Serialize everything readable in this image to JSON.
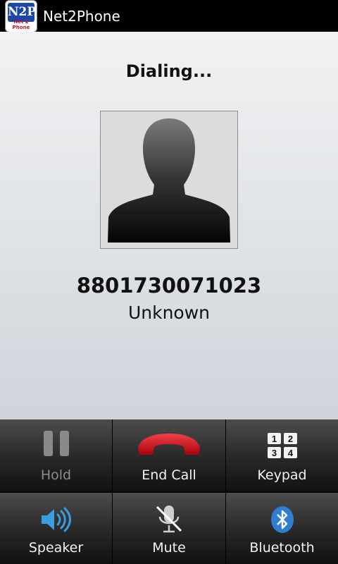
{
  "titlebar": {
    "app_title": "Net2Phone",
    "logo_mark": "N2P",
    "logo_caption": "Net 2 Phone"
  },
  "call": {
    "status": "Dialing...",
    "number": "8801730071023",
    "name": "Unknown",
    "photo": "default-silhouette-icon"
  },
  "controls": {
    "hold": {
      "label": "Hold",
      "icon": "pause-icon",
      "enabled": false
    },
    "end_call": {
      "label": "End Call",
      "icon": "phone-hangup-icon",
      "color": "#d0121b"
    },
    "keypad": {
      "label": "Keypad",
      "icon": "keypad-icon",
      "keys": [
        "1",
        "2",
        "3",
        "4"
      ]
    },
    "speaker": {
      "label": "Speaker",
      "icon": "speaker-icon",
      "color": "#3a9de0"
    },
    "mute": {
      "label": "Mute",
      "icon": "mic-muted-icon"
    },
    "bluetooth": {
      "label": "Bluetooth",
      "icon": "bluetooth-icon",
      "color": "#2f7fd1"
    }
  }
}
